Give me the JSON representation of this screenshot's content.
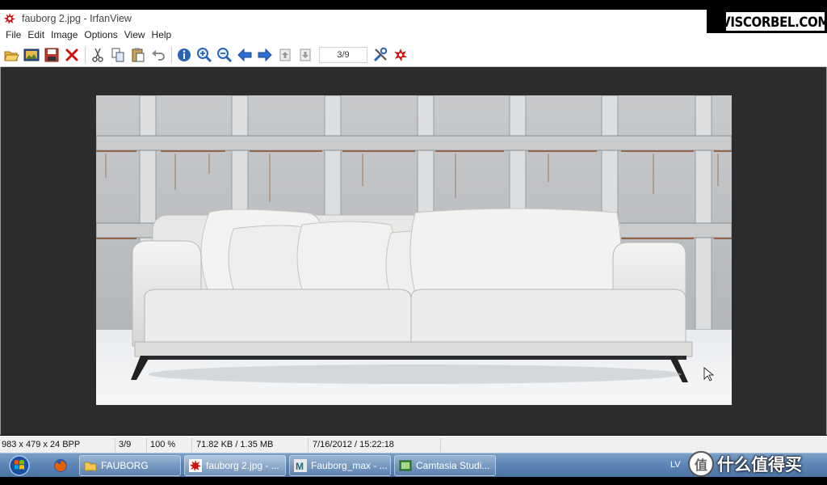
{
  "window": {
    "title": "fauborg 2.jpg - IrfanView",
    "app_icon": "irfanview-red-splat-icon"
  },
  "watermark": {
    "text": "VISCORBEL.COM"
  },
  "menu": {
    "items": [
      "File",
      "Edit",
      "Image",
      "Options",
      "View",
      "Help"
    ]
  },
  "toolbar": {
    "buttons": [
      "open-icon",
      "thumbnails-icon",
      "save-icon",
      "delete-icon",
      "cut-icon",
      "copy-icon",
      "paste-icon",
      "undo-icon",
      "info-icon",
      "zoom-in-icon",
      "zoom-out-icon",
      "previous-icon",
      "next-icon",
      "first-page-icon",
      "last-page-icon",
      "page-counter",
      "properties-icon",
      "about-icon"
    ],
    "page_value": "3/9"
  },
  "status": {
    "dimensions": "983 x 479 x 24 BPP",
    "index": "3/9",
    "zoom": "100 %",
    "size": "71.82 KB / 1.35 MB",
    "datetime": "7/16/2012 / 15:22:18"
  },
  "taskbar": {
    "tasks": [
      {
        "label": "FAUBORG",
        "icon": "folder-icon"
      },
      {
        "label": "fauborg 2.jpg - ...",
        "icon": "irfanview-icon"
      },
      {
        "label": "Fauborg_max - ...",
        "icon": "3dsmax-icon"
      },
      {
        "label": "Camtasia Studi...",
        "icon": "camtasia-icon"
      }
    ],
    "lang": "LV"
  },
  "overlay_logo": {
    "badge": "值",
    "text": "什么值得买"
  },
  "colors": {
    "viewer_bg": "#2c2c2c",
    "taskbar": "#5e86b6",
    "irfan_red": "#d01010"
  }
}
